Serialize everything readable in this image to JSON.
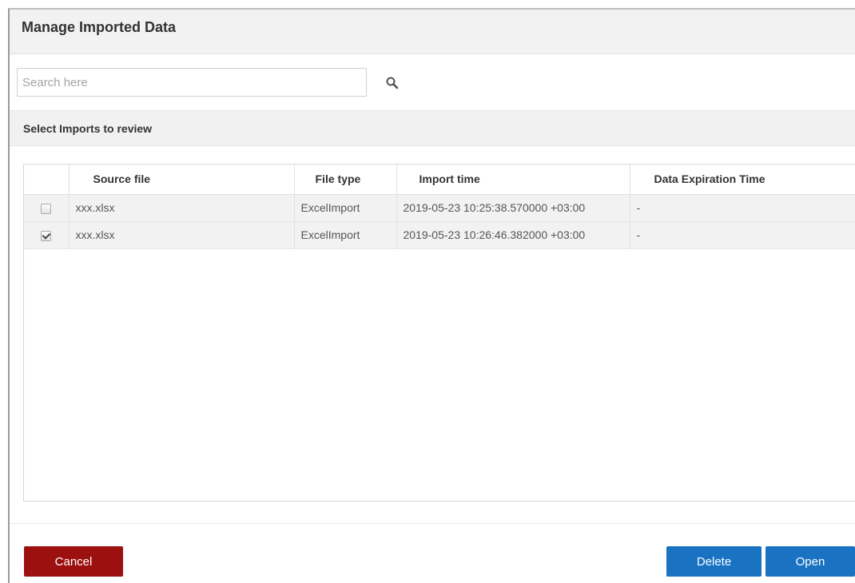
{
  "dialog": {
    "title": "Manage Imported Data"
  },
  "search": {
    "placeholder": "Search here",
    "value": ""
  },
  "section": {
    "title": "Select Imports to review"
  },
  "table": {
    "columns": [
      "",
      "Source file",
      "File type",
      "Import time",
      "Data Expiration Time"
    ],
    "rows": [
      {
        "checked": false,
        "source_file": "xxx.xlsx",
        "file_type": "ExcelImport",
        "import_time": "2019-05-23 10:25:38.570000 +03:00",
        "expiration": "-"
      },
      {
        "checked": true,
        "source_file": "xxx.xlsx",
        "file_type": "ExcelImport",
        "import_time": "2019-05-23 10:26:46.382000 +03:00",
        "expiration": "-"
      }
    ]
  },
  "buttons": {
    "cancel": "Cancel",
    "delete": "Delete",
    "open": "Open"
  },
  "colors": {
    "cancel_bg": "#9c1010",
    "primary_bg": "#1a72c2",
    "header_bg": "#f2f2f2",
    "row_bg": "#f2f2f2"
  },
  "icons": {
    "search": "search-icon"
  }
}
